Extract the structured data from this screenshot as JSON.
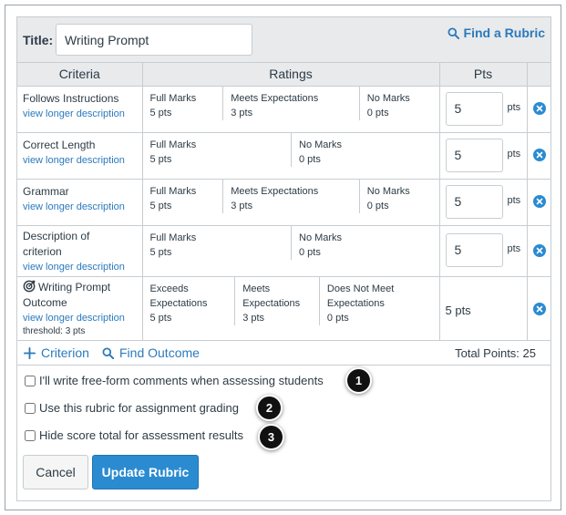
{
  "title": {
    "label": "Title:",
    "value": "Writing Prompt"
  },
  "find_rubric": "Find a Rubric",
  "columns": {
    "criteria": "Criteria",
    "ratings": "Ratings",
    "pts": "Pts"
  },
  "pts_suffix": "pts",
  "view_longer": "view longer description",
  "criteria": [
    {
      "name": "Follows Instructions",
      "ratings": [
        {
          "label": "Full Marks",
          "pts": "5 pts"
        },
        {
          "label": "Meets Expectations",
          "pts": "3 pts"
        },
        {
          "label": "No Marks",
          "pts": "0 pts"
        }
      ],
      "points": "5"
    },
    {
      "name": "Correct Length",
      "ratings": [
        {
          "label": "Full Marks",
          "pts": "5 pts"
        },
        {
          "label": "No Marks",
          "pts": "0 pts"
        }
      ],
      "points": "5"
    },
    {
      "name": "Grammar",
      "ratings": [
        {
          "label": "Full Marks",
          "pts": "5 pts"
        },
        {
          "label": "Meets Expectations",
          "pts": "3 pts"
        },
        {
          "label": "No Marks",
          "pts": "0 pts"
        }
      ],
      "points": "5"
    },
    {
      "name": "Description of criterion",
      "ratings": [
        {
          "label": "Full Marks",
          "pts": "5 pts"
        },
        {
          "label": "No Marks",
          "pts": "0 pts"
        }
      ],
      "points": "5"
    },
    {
      "name": "Writing Prompt Outcome",
      "threshold": "threshold: 3 pts",
      "ratings": [
        {
          "label": "Exceeds Expectations",
          "pts": "5 pts"
        },
        {
          "label": "Meets Expectations",
          "pts": "3 pts"
        },
        {
          "label": "Does Not Meet Expectations",
          "pts": "0 pts"
        }
      ],
      "points": "5 pts"
    }
  ],
  "footer": {
    "add_criterion": "Criterion",
    "find_outcome": "Find Outcome",
    "total": "Total Points: 25"
  },
  "options": [
    {
      "label": "I'll write free-form comments when assessing students",
      "badge": "1"
    },
    {
      "label": "Use this rubric for assignment grading",
      "badge": "2"
    },
    {
      "label": "Hide score total for assessment results",
      "badge": "3"
    }
  ],
  "buttons": {
    "cancel": "Cancel",
    "update": "Update Rubric"
  },
  "colors": {
    "link": "#2b7abc",
    "primary": "#2b8bd1",
    "header_bg": "#e8eaec",
    "badge": "#111111"
  }
}
